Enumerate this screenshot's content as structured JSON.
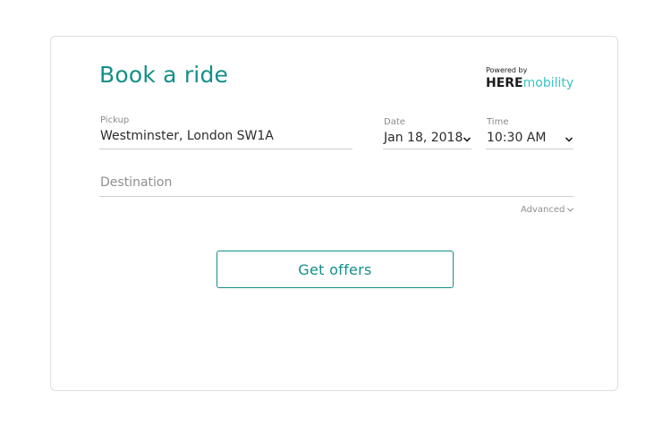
{
  "form": {
    "title": "Book a ride",
    "brand": {
      "powered_by": "Powered by",
      "here": "HERE",
      "mobility": "mobility"
    },
    "pickup": {
      "label": "Pickup",
      "value": "Westminster, London SW1A"
    },
    "date": {
      "label": "Date",
      "value": "Jan 18, 2018"
    },
    "time": {
      "label": "Time",
      "value": "10:30 AM"
    },
    "destination": {
      "placeholder": "Destination"
    },
    "advanced_label": "Advanced",
    "submit_label": "Get offers"
  },
  "colors": {
    "accent": "#138f87",
    "brand_mobility": "#3cc3c3",
    "border": "#dedede"
  },
  "icons": [
    "chevron-down-icon",
    "chevron-down-icon",
    "chevron-down-icon"
  ]
}
